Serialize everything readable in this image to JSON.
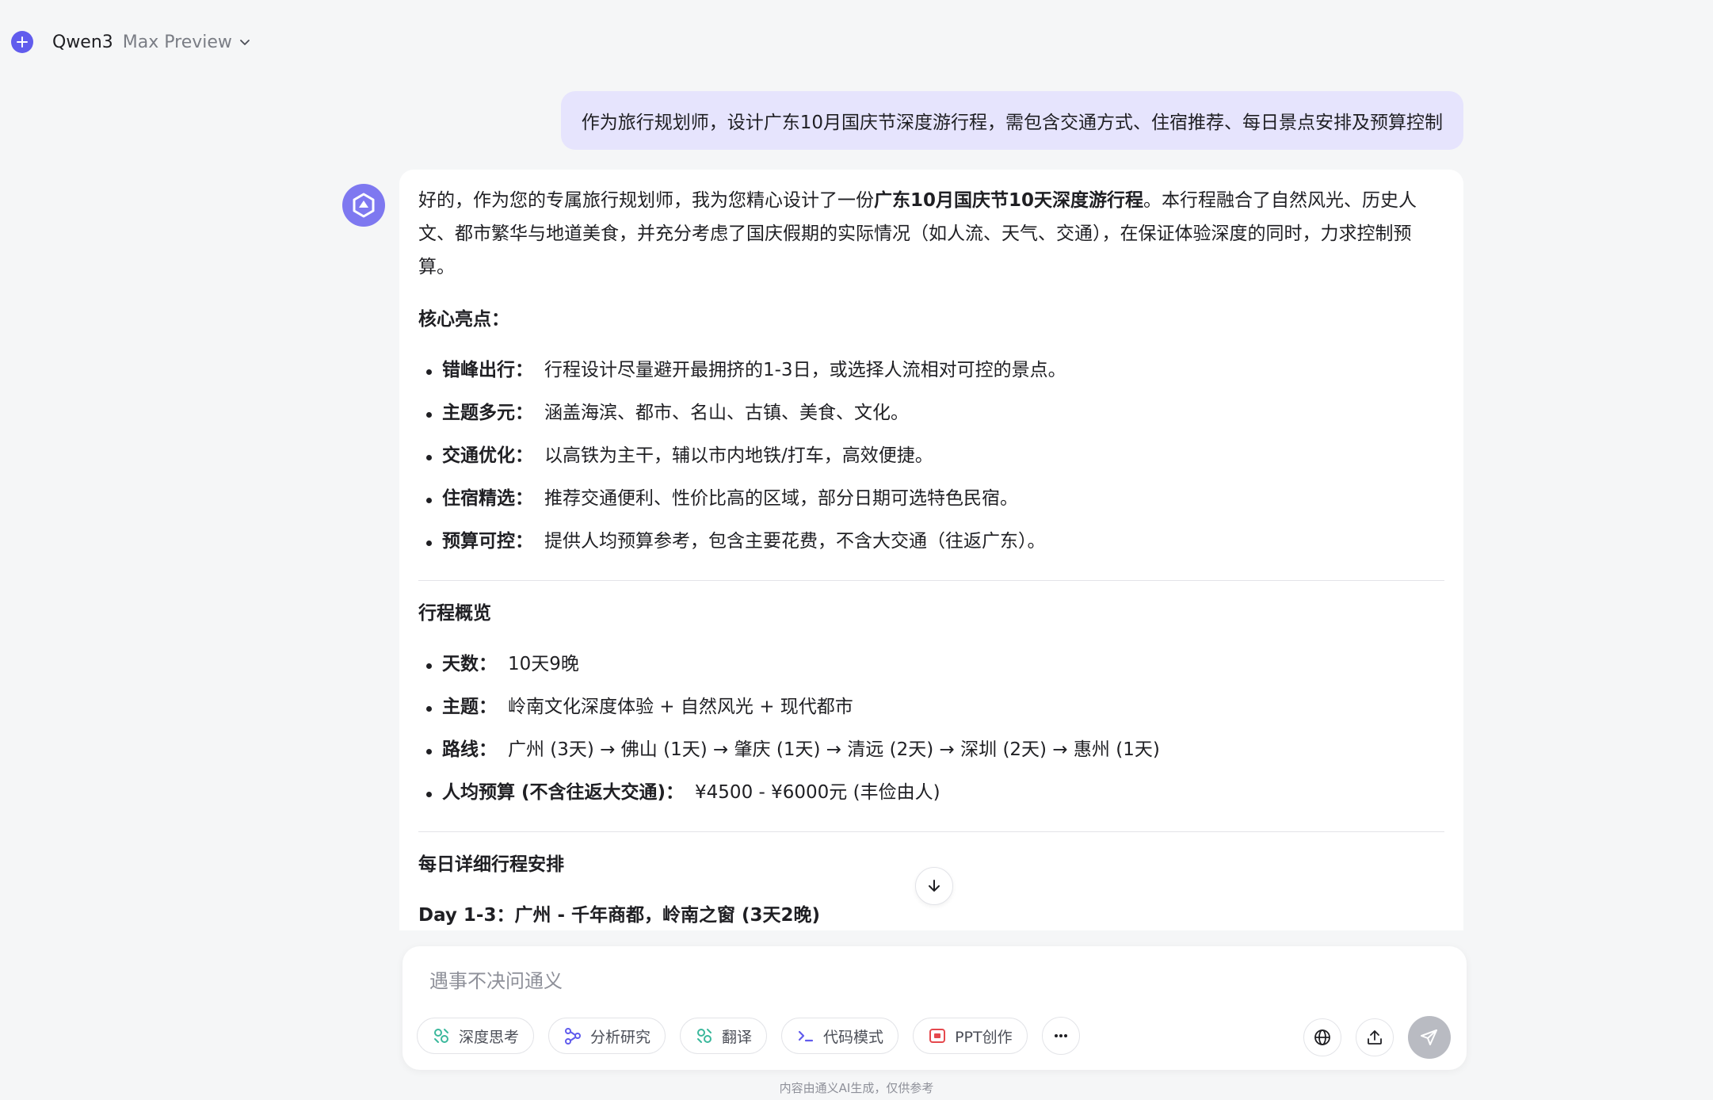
{
  "header": {
    "model_name": "Qwen3",
    "model_variant": "Max Preview"
  },
  "user_message": "作为旅行规划师，设计广东10月国庆节深度游行程，需包含交通方式、住宿推荐、每日景点安排及预算控制",
  "answer": {
    "intro_pre": "好的，作为您的专属旅行规划师，我为您精心设计了一份",
    "intro_bold": "广东10月国庆节10天深度游行程",
    "intro_post": "。本行程融合了自然风光、历史人文、都市繁华与地道美食，并充分考虑了国庆假期的实际情况（如人流、天气、交通），在保证体验深度的同时，力求控制预算。",
    "highlights_title": "核心亮点：",
    "highlights": [
      {
        "label": "错峰出行：",
        "text": "行程设计尽量避开最拥挤的1-3日，或选择人流相对可控的景点。"
      },
      {
        "label": "主题多元：",
        "text": "涵盖海滨、都市、名山、古镇、美食、文化。"
      },
      {
        "label": "交通优化：",
        "text": "以高铁为主干，辅以市内地铁/打车，高效便捷。"
      },
      {
        "label": "住宿精选：",
        "text": "推荐交通便利、性价比高的区域，部分日期可选特色民宿。"
      },
      {
        "label": "预算可控：",
        "text": "提供人均预算参考，包含主要花费，不含大交通（往返广东）。"
      }
    ],
    "overview_title": "行程概览",
    "overview": [
      {
        "label": "天数：",
        "text": "10天9晚"
      },
      {
        "label": "主题：",
        "text": "岭南文化深度体验 + 自然风光 + 现代都市"
      },
      {
        "label": "路线：",
        "text": "广州 (3天) → 佛山 (1天) → 肇庆 (1天) → 清远 (2天) → 深圳 (2天) → 惠州 (1天)"
      },
      {
        "label": "人均预算 (不含往返大交通)：",
        "text": "¥4500 - ¥6000元 (丰俭由人)"
      }
    ],
    "daily_title": "每日详细行程安排",
    "day_1_title": "Day 1-3：广州 - 千年商都，岭南之窗 (3天2晚)"
  },
  "composer": {
    "placeholder": "遇事不决问通义",
    "tools": [
      {
        "label": "深度思考",
        "icon": "deep-think-icon"
      },
      {
        "label": "分析研究",
        "icon": "research-icon"
      },
      {
        "label": "翻译",
        "icon": "translate-icon"
      },
      {
        "label": "代码模式",
        "icon": "code-icon"
      },
      {
        "label": "PPT创作",
        "icon": "ppt-icon"
      }
    ]
  },
  "footer": {
    "disclaimer": "内容由通义AI生成，仅供参考"
  },
  "colors": {
    "accent": "#615ced",
    "user_bubble": "#e6e4fd",
    "background": "#f5f6f7"
  }
}
